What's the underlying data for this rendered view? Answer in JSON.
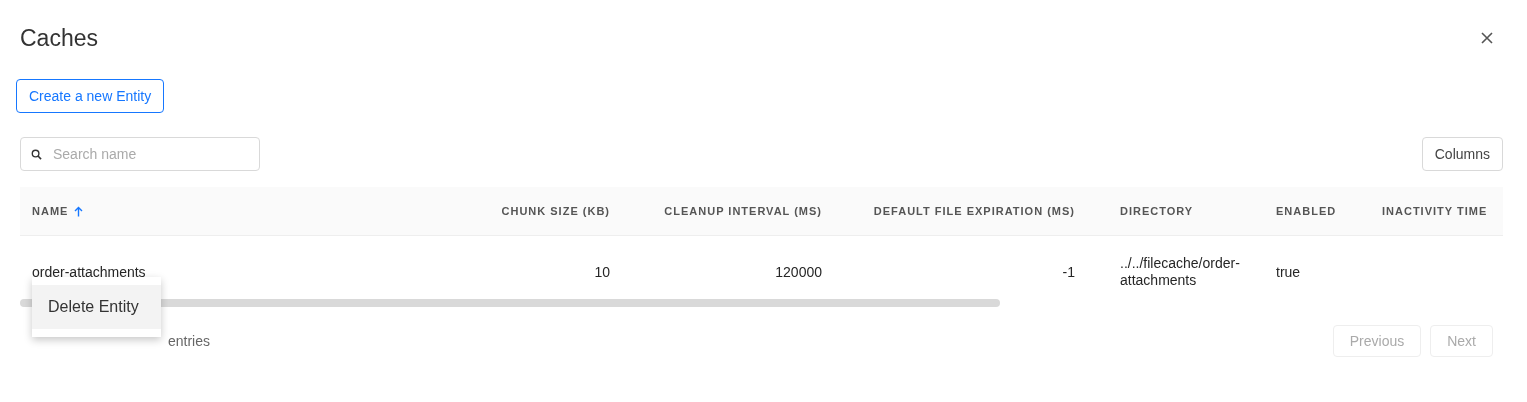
{
  "dialog": {
    "title": "Caches"
  },
  "create_button": "Create a new Entity",
  "search": {
    "placeholder": "Search name"
  },
  "columns_button": "Columns",
  "table": {
    "columns": [
      {
        "label": "NAME",
        "numeric": false,
        "sorted_ascending": true
      },
      {
        "label": "CHUNK SIZE (KB)",
        "numeric": true
      },
      {
        "label": "CLEANUP INTERVAL (MS)",
        "numeric": true
      },
      {
        "label": "DEFAULT FILE EXPIRATION (MS)",
        "numeric": true
      },
      {
        "label": "DIRECTORY",
        "numeric": false
      },
      {
        "label": "ENABLED",
        "numeric": false
      },
      {
        "label": "INACTIVITY TIME",
        "numeric": false
      }
    ],
    "rows": [
      {
        "cells": [
          "order-attachments",
          "10",
          "120000",
          "-1",
          "../../filecache/order-attachments",
          "true",
          ""
        ]
      }
    ]
  },
  "context_menu": {
    "items": [
      {
        "label": "Delete Entity",
        "selected": true
      }
    ]
  },
  "footer_text": "entries",
  "pagination": [
    {
      "label": "Previous",
      "disabled": true
    },
    {
      "label": "Next",
      "disabled": true
    }
  ]
}
